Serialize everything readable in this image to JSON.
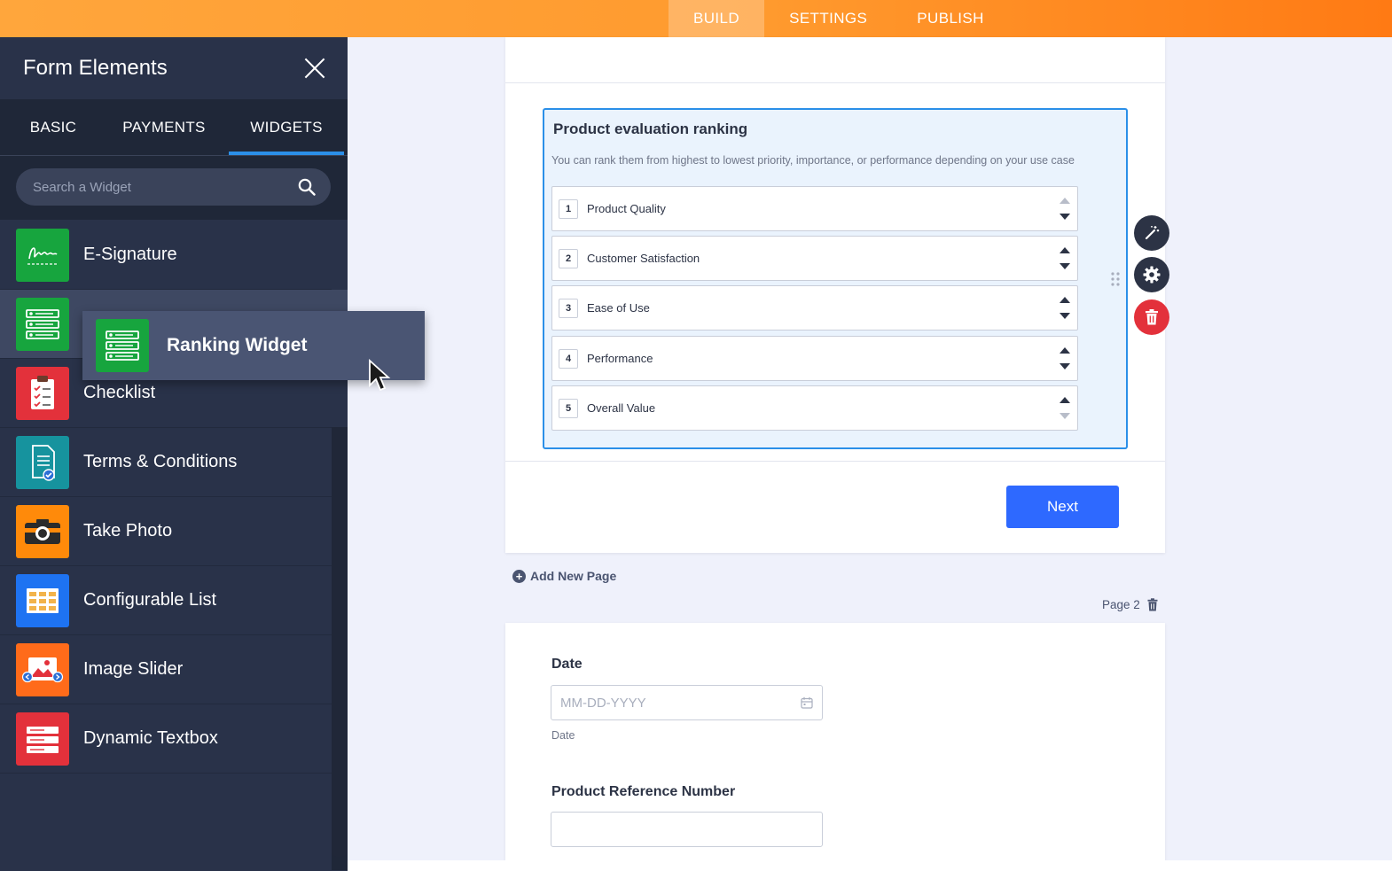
{
  "topnav": {
    "tabs": [
      "BUILD",
      "SETTINGS",
      "PUBLISH"
    ],
    "active": "BUILD"
  },
  "sidebar": {
    "title": "Form Elements",
    "tabs": [
      "BASIC",
      "PAYMENTS",
      "WIDGETS"
    ],
    "active_tab": "WIDGETS",
    "search_placeholder": "Search a Widget",
    "items": [
      {
        "label": "E-Signature",
        "icon": "signature-icon",
        "color": "#17a53e"
      },
      {
        "label": "",
        "icon": "ranking-icon",
        "color": "#17a53e"
      },
      {
        "label": "Checklist",
        "icon": "checklist-icon",
        "color": "#e3313b"
      },
      {
        "label": "Terms & Conditions",
        "icon": "document-check-icon",
        "color": "#16939e"
      },
      {
        "label": "Take Photo",
        "icon": "camera-icon",
        "color": "#ff8a0a"
      },
      {
        "label": "Configurable List",
        "icon": "list-grid-icon",
        "color": "#1e73f2"
      },
      {
        "label": "Image Slider",
        "icon": "image-slider-icon",
        "color": "#ff6b1a"
      },
      {
        "label": "Dynamic Textbox",
        "icon": "textbox-icon",
        "color": "#e3313b"
      }
    ],
    "dragging": {
      "label": "Ranking Widget",
      "icon": "ranking-icon"
    }
  },
  "form": {
    "ranking": {
      "title": "Product evaluation ranking",
      "description": "You can rank them from highest to lowest priority, importance, or performance depending on your use case",
      "rows": [
        {
          "num": "1",
          "label": "Product Quality"
        },
        {
          "num": "2",
          "label": "Customer Satisfaction"
        },
        {
          "num": "3",
          "label": "Ease of Use"
        },
        {
          "num": "4",
          "label": "Performance"
        },
        {
          "num": "5",
          "label": "Overall Value"
        }
      ]
    },
    "next_label": "Next",
    "add_page_label": "Add New Page",
    "page2_label": "Page 2",
    "date_label": "Date",
    "date_placeholder": "MM-DD-YYYY",
    "date_sublabel": "Date",
    "ref_label": "Product Reference Number"
  },
  "colors": {
    "accent": "#ff9a2e",
    "sidebar": "#293249",
    "primary_button": "#2e69ff",
    "delete": "#e3313b",
    "selection": "#2b8fe8"
  }
}
